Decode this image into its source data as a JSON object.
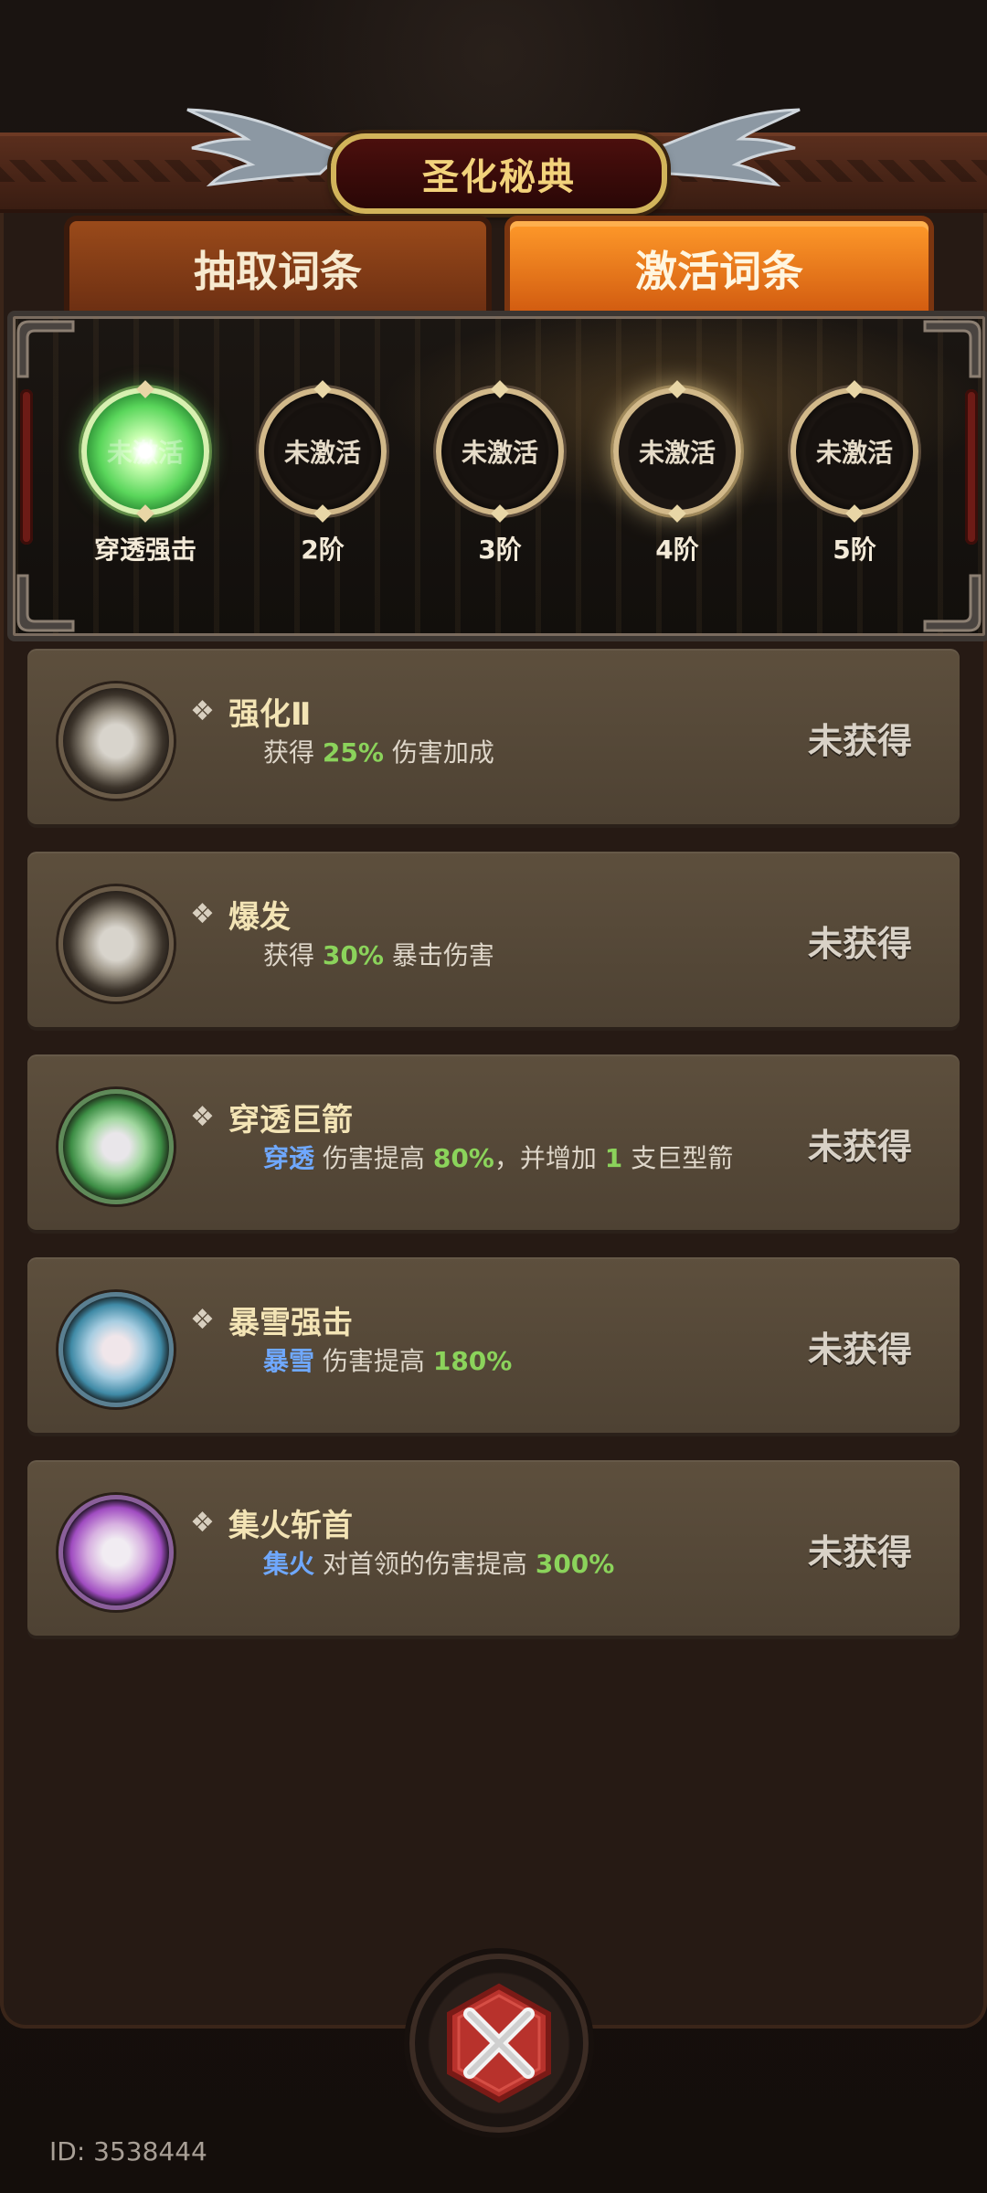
{
  "title": "圣化秘典",
  "tabs": {
    "draw": "抽取词条",
    "activate": "激活词条"
  },
  "tiers": [
    {
      "orb": "未激活",
      "label": "穿透强击",
      "active": true
    },
    {
      "orb": "未激活",
      "label": "2阶",
      "active": false
    },
    {
      "orb": "未激活",
      "label": "3阶",
      "active": false
    },
    {
      "orb": "未激活",
      "label": "4阶",
      "active": false
    },
    {
      "orb": "未激活",
      "label": "5阶",
      "active": false
    }
  ],
  "affixes": [
    {
      "name": "强化Ⅱ",
      "desc_pre": "获得",
      "desc_num": "25%",
      "desc_post": "伤害加成",
      "status": "未获得",
      "gem": "gray"
    },
    {
      "name": "爆发",
      "desc_pre": "获得",
      "desc_num": "30%",
      "desc_post": "暴击伤害",
      "status": "未获得",
      "gem": "gray"
    },
    {
      "name": "穿透巨箭",
      "desc_kw": "穿透",
      "desc_mid": "伤害提高",
      "desc_num": "80%",
      "desc_sep": "，并增加",
      "desc_num2": "1",
      "desc_post": "支巨型箭",
      "status": "未获得",
      "gem": "green"
    },
    {
      "name": "暴雪强击",
      "desc_kw": "暴雪",
      "desc_mid": "伤害提高",
      "desc_num": "180%",
      "status": "未获得",
      "gem": "blue"
    },
    {
      "name": "集火斩首",
      "desc_kw": "集火",
      "desc_mid": "对首领的伤害提高",
      "desc_num": "300%",
      "status": "未获得",
      "gem": "purple"
    }
  ],
  "footer": {
    "id": "ID: 3538444"
  },
  "colors": {
    "accent_orange": "#ff9a2a",
    "gold": "#f2d27b",
    "keyword_blue": "#6fa8ff",
    "number_green": "#8bd35b"
  }
}
